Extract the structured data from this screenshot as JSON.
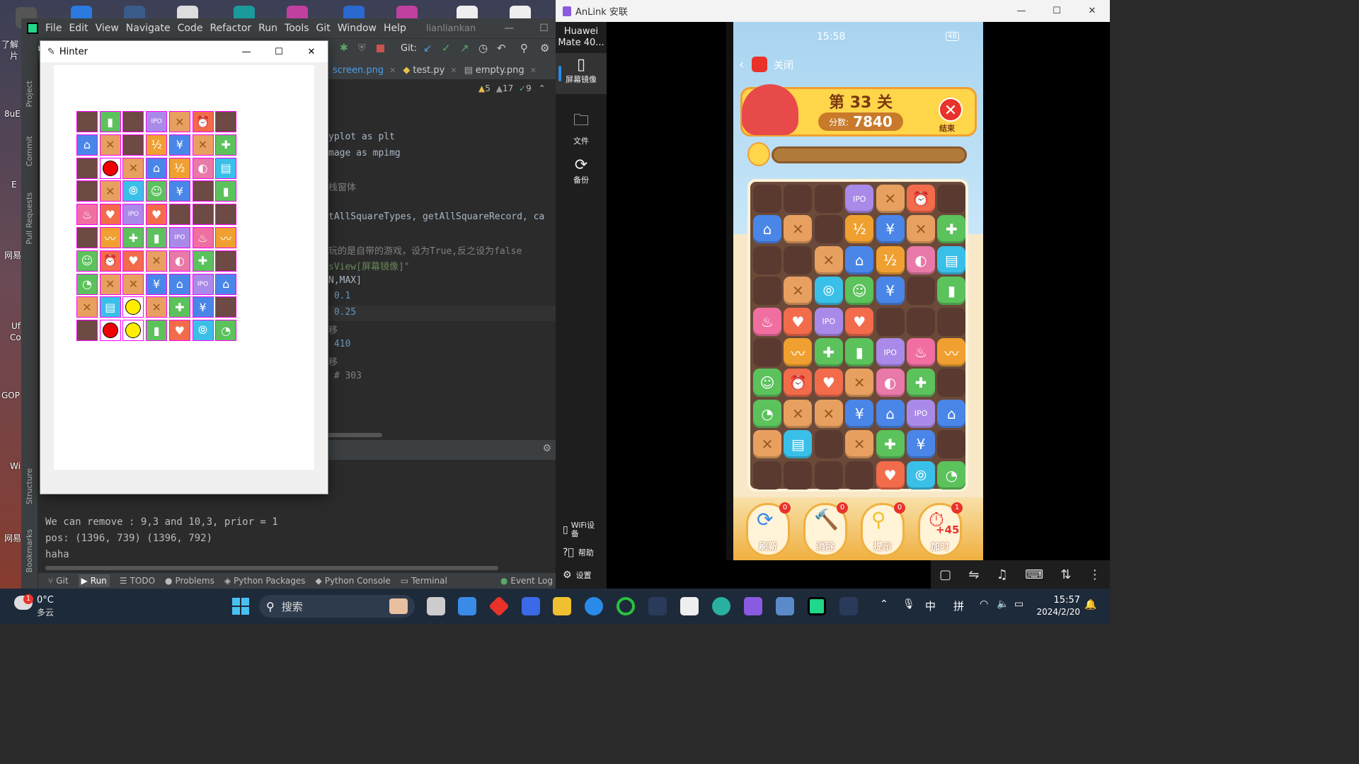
{
  "desktop": {
    "labels": [
      "了解",
      "片",
      "8uE",
      "E",
      "网易",
      "Uf",
      "Co",
      "GOP",
      "Wi",
      "网易"
    ]
  },
  "pycharm": {
    "menu": [
      "File",
      "Edit",
      "View",
      "Navigate",
      "Code",
      "Refactor",
      "Run",
      "Tools",
      "Git",
      "Window",
      "Help"
    ],
    "project_name": "lianliankan",
    "project_short": "lia",
    "git_label": "Git:",
    "tabs": [
      {
        "label": "screen.png"
      },
      {
        "label": "test.py"
      },
      {
        "label": "empty.png"
      }
    ],
    "inspections": {
      "warn1": "5",
      "warn2": "17",
      "ok": "9"
    },
    "code_lines": [
      "yplot as plt",
      "mage as mpimg",
      "",
      "栈窗体",
      "",
      "tAllSquareTypes, getAllSquareRecord, ca",
      "",
      "玩的是自带的游戏，设为True,反之设为false",
      "sView[屏幕镜像]\"",
      "N,MAX]",
      " 0.1",
      " 0.25",
      "移",
      " 410",
      "移",
      " # 303"
    ],
    "console_lines": [
      "We can remove : 9,3 and 10,3, prior = 1",
      "pos: (1396, 739) (1396, 792)",
      "haha"
    ],
    "left_strip": [
      "Project",
      "Commit",
      "Pull Requests",
      "Structure",
      "Bookmarks"
    ],
    "bottom_tabs": [
      "Git",
      "Run",
      "TODO",
      "Problems",
      "Python Packages",
      "Python Console",
      "Terminal",
      "Event Log"
    ]
  },
  "hinter": {
    "title": "Hinter",
    "grid": [
      [
        "empty",
        "book",
        "empty",
        "ipo",
        "crate",
        "alarm",
        "empty"
      ],
      [
        "house",
        "crate",
        "empty",
        "half",
        "yen",
        "crate",
        "medkit"
      ],
      [
        "empty",
        "red",
        "crate",
        "house",
        "half",
        "planet",
        "wifi"
      ],
      [
        "empty",
        "crate",
        "bulb",
        "person",
        "yen",
        "empty",
        "book"
      ],
      [
        "fire",
        "pig",
        "ipo",
        "pig",
        "empty",
        "empty",
        "empty"
      ],
      [
        "empty",
        "chart",
        "medkit",
        "book",
        "ipo",
        "fire",
        "chart"
      ],
      [
        "person",
        "alarm",
        "pig",
        "crate",
        "planet",
        "medkit",
        "empty"
      ],
      [
        "pie",
        "crate",
        "crate",
        "yen",
        "house",
        "ipo",
        "house"
      ],
      [
        "crate",
        "wifi",
        "yellow",
        "crate",
        "medkit",
        "yen",
        "empty"
      ],
      [
        "empty",
        "red",
        "yellow",
        "book",
        "pig",
        "bulb",
        "pie"
      ]
    ]
  },
  "anlink": {
    "title": "AnLink 安联",
    "device_name": "Huawei Mate 40...",
    "side": [
      {
        "label": "屏幕镜像",
        "icon": "phone-icon"
      },
      {
        "label": "文件",
        "icon": "folder-icon"
      },
      {
        "label": "备份",
        "icon": "sync-icon"
      },
      {
        "label": "WiFi设备",
        "icon": "wifi-device-icon"
      },
      {
        "label": "帮助",
        "icon": "help-icon"
      },
      {
        "label": "设置",
        "icon": "settings-icon"
      }
    ],
    "phone": {
      "time": "15:58",
      "battery": "48",
      "close_label": "关闭",
      "level": "第 33 关",
      "score_label": "分数:",
      "score": "7840",
      "end_label": "结束",
      "timer_progress": 1.0,
      "grid": [
        [
          "empty",
          "empty",
          "empty",
          "ipo",
          "crate",
          "alarm",
          "empty"
        ],
        [
          "house",
          "crate",
          "empty",
          "half",
          "yen",
          "crate",
          "medkit"
        ],
        [
          "empty",
          "empty",
          "crate",
          "house",
          "half",
          "planet",
          "wifi"
        ],
        [
          "empty",
          "crate",
          "bulb",
          "person",
          "yen",
          "empty",
          "book"
        ],
        [
          "fire",
          "pig",
          "ipo",
          "pig",
          "empty",
          "empty",
          "empty"
        ],
        [
          "empty",
          "chart",
          "medkit",
          "book",
          "ipo",
          "fire",
          "chart"
        ],
        [
          "person",
          "alarm",
          "pig",
          "crate",
          "planet",
          "medkit",
          "empty"
        ],
        [
          "pie",
          "crate",
          "crate",
          "yen",
          "house",
          "ipo",
          "house"
        ],
        [
          "crate",
          "wifi",
          "empty",
          "crate",
          "medkit",
          "yen",
          "empty"
        ],
        [
          "empty",
          "empty",
          "empty",
          "empty",
          "pig",
          "bulb",
          "pie"
        ]
      ],
      "powerups": [
        {
          "label": "刷新",
          "count": "0"
        },
        {
          "label": "消除",
          "count": "0"
        },
        {
          "label": "提示",
          "count": "0"
        },
        {
          "label": "加时",
          "count": "1",
          "extra": "+45"
        }
      ]
    }
  },
  "taskbar": {
    "weather_temp": "0°C",
    "weather_desc": "多云",
    "weather_badge": "1",
    "search_placeholder": "搜索",
    "ime1": "中",
    "ime2": "拼",
    "time": "15:57",
    "date": "2024/2/20"
  },
  "colors": {
    "empty": "#6d4a44",
    "book": "#5cc25c",
    "ipo": "#a98ae8",
    "crate": "#e8a060",
    "alarm": "#f26b4b",
    "house": "#4a86e8",
    "half": "#f0a030",
    "yen": "#4a86e8",
    "medkit": "#5cc25c",
    "planet": "#e879a8",
    "wifi": "#3ac0e8",
    "bulb": "#3ac0e8",
    "person": "#5cc25c",
    "fire": "#f06fa0",
    "pig": "#f26b4b",
    "chart": "#f0a030",
    "pie": "#5cc25c",
    "red": "#ee0000",
    "yellow": "#ffee00"
  }
}
